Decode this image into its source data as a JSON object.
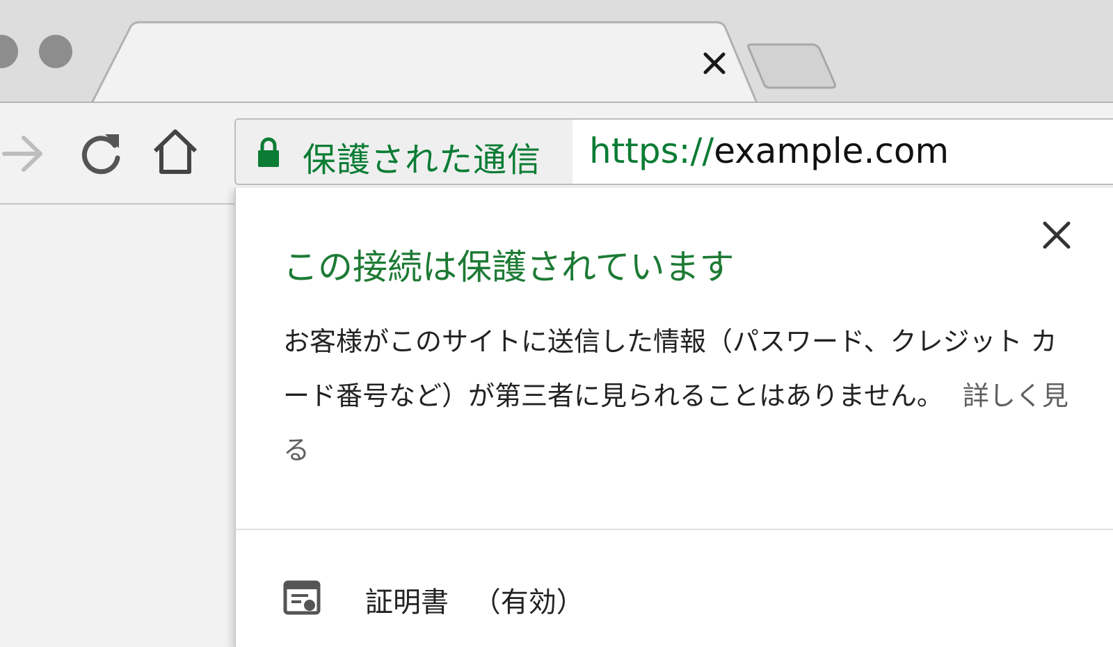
{
  "window": {
    "controls": [
      "close-dot",
      "minimize-dot"
    ],
    "colors": {
      "dot": "#8d8d8d",
      "tabstrip": "#dddddd",
      "toolbar": "#f2f2f2"
    }
  },
  "tab": {
    "close_icon": "close-icon",
    "new_tab_icon": "new-tab-icon"
  },
  "toolbar": {
    "forward_icon": "arrow-right-icon",
    "reload_icon": "reload-icon",
    "home_icon": "home-icon"
  },
  "omnibox": {
    "security_label": "保護された通信",
    "lock_icon": "lock-icon",
    "url_scheme": "https://",
    "url_host": "example.com",
    "colors": {
      "secure": "#0b7c34"
    }
  },
  "popup": {
    "title": "この接続は保護されています",
    "body": "お客様がこのサイトに送信した情報（パスワード、クレジット カード番号など）が第三者に見られることはありません。",
    "learn_more": "詳しく見る",
    "close_icon": "close-icon",
    "certificate": {
      "label": "証明書",
      "status": "（有効）",
      "icon": "certificate-icon"
    },
    "colors": {
      "title": "#1d7a34"
    }
  }
}
